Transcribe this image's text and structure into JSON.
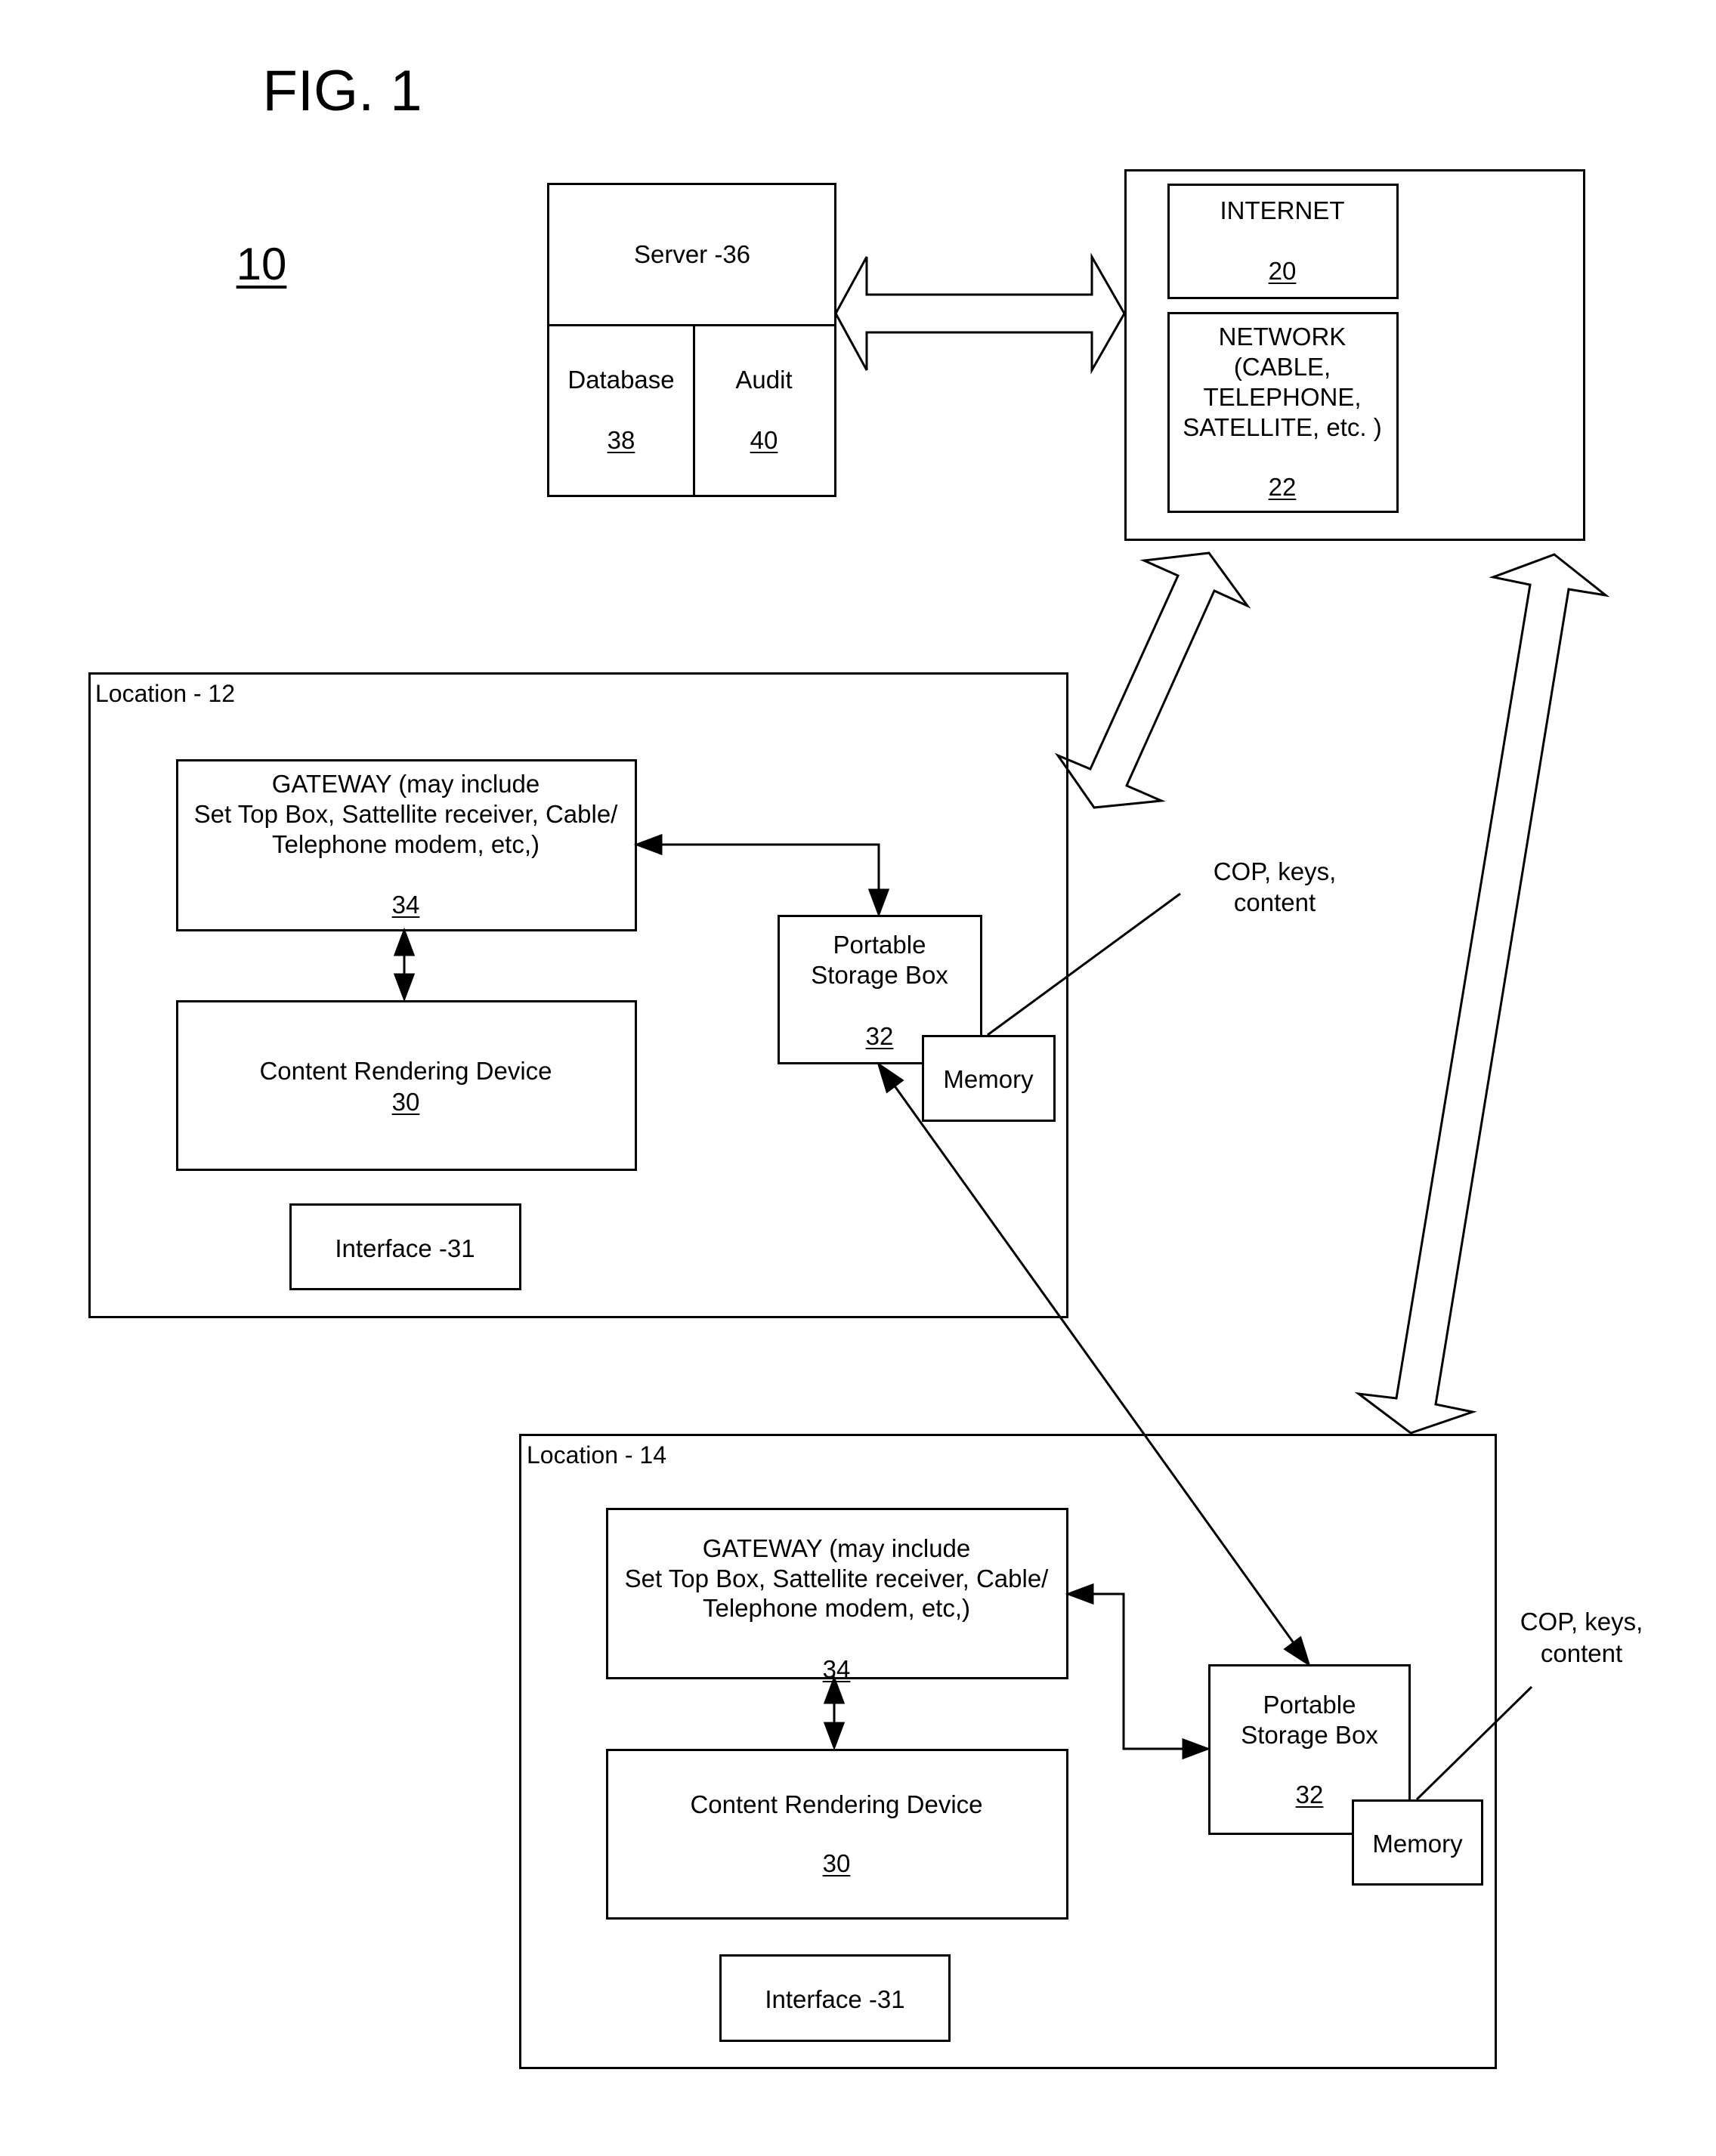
{
  "figure": {
    "title": "FIG. 1",
    "reference": "10"
  },
  "server": {
    "label": "Server -36",
    "database": {
      "label": "Database",
      "ref": "38"
    },
    "audit": {
      "label": "Audit",
      "ref": "40"
    }
  },
  "cloud": {
    "internet": {
      "label": "INTERNET",
      "ref": "20"
    },
    "network": {
      "lines": [
        "NETWORK",
        "(CABLE,",
        "TELEPHONE,",
        "SATELLITE, etc. )"
      ],
      "ref": "22"
    }
  },
  "locations": [
    {
      "label": "Location - 12",
      "gateway": {
        "lines": [
          "GATEWAY (may include",
          "Set Top Box, Sattellite receiver, Cable/",
          "Telephone modem, etc,)"
        ],
        "ref": "34"
      },
      "rendering_device": {
        "label": "Content Rendering Device",
        "ref": "30"
      },
      "interface": {
        "label": "Interface -31"
      },
      "storage_box": {
        "lines": [
          "Portable",
          "Storage Box"
        ],
        "ref": "32"
      },
      "memory": {
        "label": "Memory"
      },
      "annotation": {
        "lines": [
          "COP, keys,",
          "content"
        ]
      }
    },
    {
      "label": "Location - 14",
      "gateway": {
        "lines": [
          "GATEWAY (may include",
          "Set Top Box, Sattellite receiver, Cable/",
          "Telephone modem, etc,)"
        ],
        "ref": "34"
      },
      "rendering_device": {
        "label": "Content Rendering Device",
        "ref": "30"
      },
      "interface": {
        "label": "Interface -31"
      },
      "storage_box": {
        "lines": [
          "Portable",
          "Storage Box"
        ],
        "ref": "32"
      },
      "memory": {
        "label": "Memory"
      },
      "annotation": {
        "lines": [
          "COP, keys,",
          "content"
        ]
      }
    }
  ]
}
